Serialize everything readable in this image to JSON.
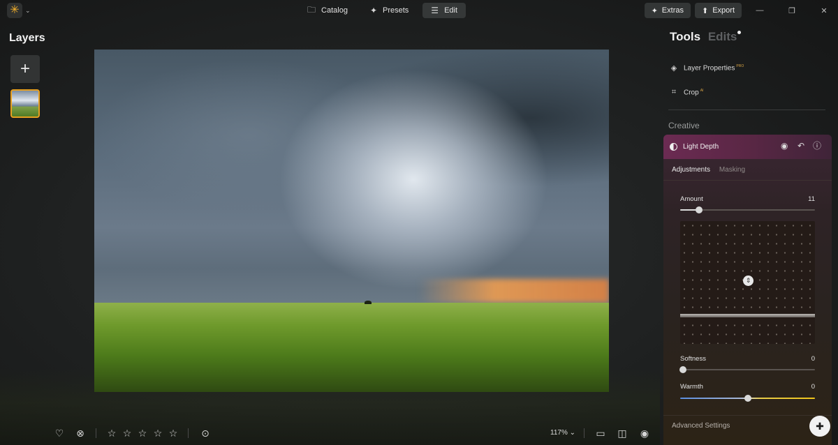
{
  "topbar": {
    "logo_icon": "luminar-sun-icon",
    "modes": [
      {
        "label": "Catalog",
        "icon": "folder-icon",
        "active": false
      },
      {
        "label": "Presets",
        "icon": "sparkle-icon",
        "active": false
      },
      {
        "label": "Edit",
        "icon": "sliders-icon",
        "active": true
      }
    ],
    "extras_label": "Extras",
    "export_label": "Export"
  },
  "layers": {
    "title": "Layers",
    "add_symbol": "+"
  },
  "bottombar": {
    "zoom": "117%",
    "rating_stars": 5,
    "rating_value": 0
  },
  "right_panel": {
    "tab_tools": "Tools",
    "tab_edits": "Edits",
    "tools": [
      {
        "label": "Layer Properties",
        "badge": "PRO",
        "icon": "layers-icon"
      },
      {
        "label": "Crop",
        "badge": "AI",
        "icon": "crop-icon"
      }
    ],
    "section": "Creative",
    "light_depth": {
      "title": "Light Depth",
      "tab_adjustments": "Adjustments",
      "tab_masking": "Masking",
      "amount_label": "Amount",
      "amount_value": "11",
      "softness_label": "Softness",
      "softness_value": "0",
      "warmth_label": "Warmth",
      "warmth_value": "0",
      "advanced": "Advanced Settings"
    }
  },
  "colors": {
    "accent_orange": "#e8a020",
    "card_header": "#6b2b52",
    "warmth_cool": "#5b8ee0",
    "warmth_warm": "#f0c419"
  }
}
